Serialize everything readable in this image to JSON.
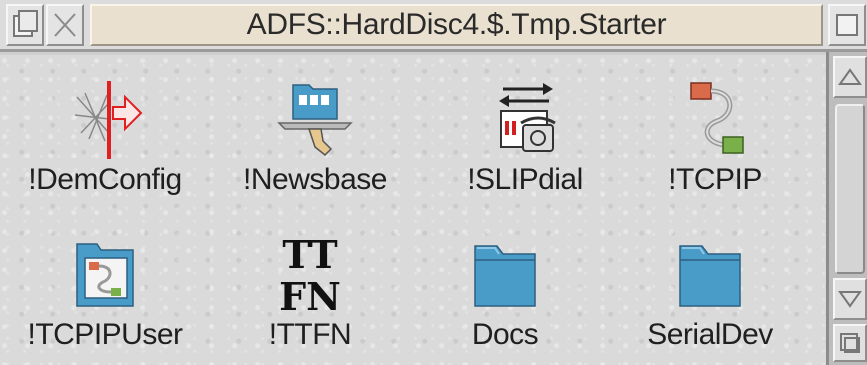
{
  "window": {
    "title": "ADFS::HardDisc4.$.Tmp.Starter"
  },
  "titlebar": {
    "back_icon": "back-icon",
    "close_icon": "close-icon",
    "toggle_icon": "toggle-size-icon"
  },
  "files": [
    {
      "label": "!DemConfig",
      "icon": "demconfig-icon"
    },
    {
      "label": "!Newsbase",
      "icon": "newsbase-icon"
    },
    {
      "label": "!SLIPdial",
      "icon": "slipdial-icon"
    },
    {
      "label": "!TCPIP",
      "icon": "tcpip-icon"
    },
    {
      "label": "!TCPIPUser",
      "icon": "tcpipuser-icon"
    },
    {
      "label": "!TTFN",
      "icon": "ttfn-icon",
      "glyph_lines": [
        "TT",
        "FN"
      ]
    },
    {
      "label": "Docs",
      "icon": "folder-icon"
    },
    {
      "label": "SerialDev",
      "icon": "folder-icon"
    }
  ],
  "colors": {
    "folder_blue": "#4a9cc8",
    "title_background": "#e9e0cf",
    "pane_background": "#dadada"
  }
}
